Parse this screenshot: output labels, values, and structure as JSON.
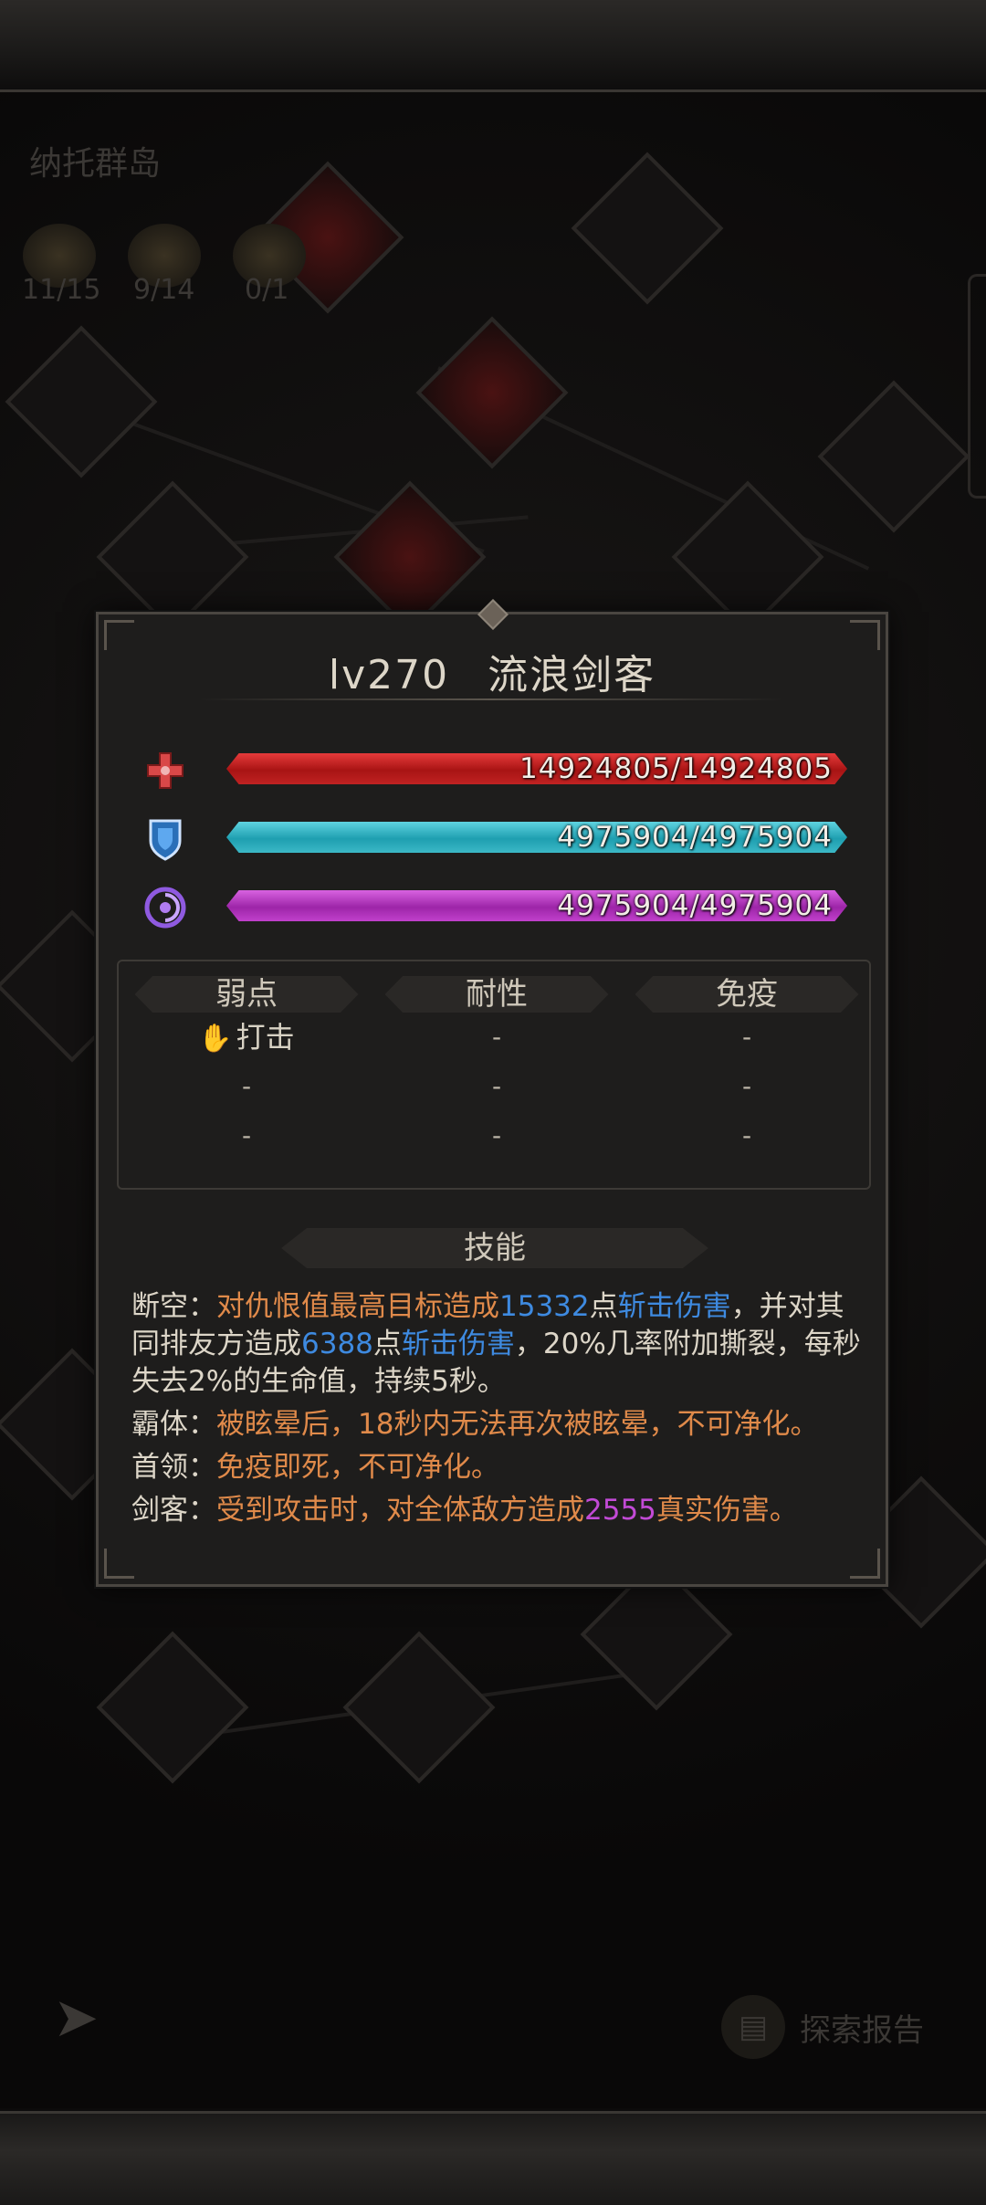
{
  "map": {
    "title": "纳托群岛",
    "counters": [
      "11/15",
      "9/14",
      "0/1"
    ],
    "report_label": "探索报告",
    "report_icon": "scroll-icon",
    "back_icon": "back-arrow-icon"
  },
  "enemy": {
    "level": "lv270",
    "name": "流浪剑客",
    "hp": {
      "text": "14924805/14924805",
      "current": 14924805,
      "max": 14924805,
      "fill": 1.0,
      "color": "#c62222",
      "icon": "health-cross-icon"
    },
    "shield": {
      "text": "4975904/4975904",
      "current": 4975904,
      "max": 4975904,
      "fill": 1.0,
      "color": "#27aab9",
      "icon": "shield-icon"
    },
    "energy": {
      "text": "4975904/4975904",
      "current": 4975904,
      "max": 4975904,
      "fill": 1.0,
      "color": "#b233bd",
      "icon": "swirl-icon"
    }
  },
  "resist": {
    "headers": [
      "弱点",
      "耐性",
      "免疫"
    ],
    "weak": [
      "打击",
      "-",
      "-"
    ],
    "tolerant": [
      "-",
      "-",
      "-"
    ],
    "immune": [
      "-",
      "-",
      "-"
    ]
  },
  "skills": {
    "header": "技能",
    "s1": {
      "label": "断空：",
      "t1": "对仇恨值最高目标造成",
      "n1": "15332",
      "t2": "点",
      "d1": "斩击伤害",
      "t3": "，并对其同排友方造成",
      "n2": "6388",
      "t4": "点",
      "d2": "斩击伤害",
      "t5": "，20%几率附加撕裂，每秒失去2%的生命值，持续5秒。"
    },
    "s2": {
      "label": "霸体：",
      "text": "被眩晕后，18秒内无法再次被眩晕，不可净化。"
    },
    "s3": {
      "label": "首领：",
      "text": "免疫即死，不可净化。"
    },
    "s4": {
      "label": "剑客：",
      "t1": "受到攻击时，对全体敌方造成",
      "n1": "2555",
      "t2": "真实伤害。"
    }
  }
}
